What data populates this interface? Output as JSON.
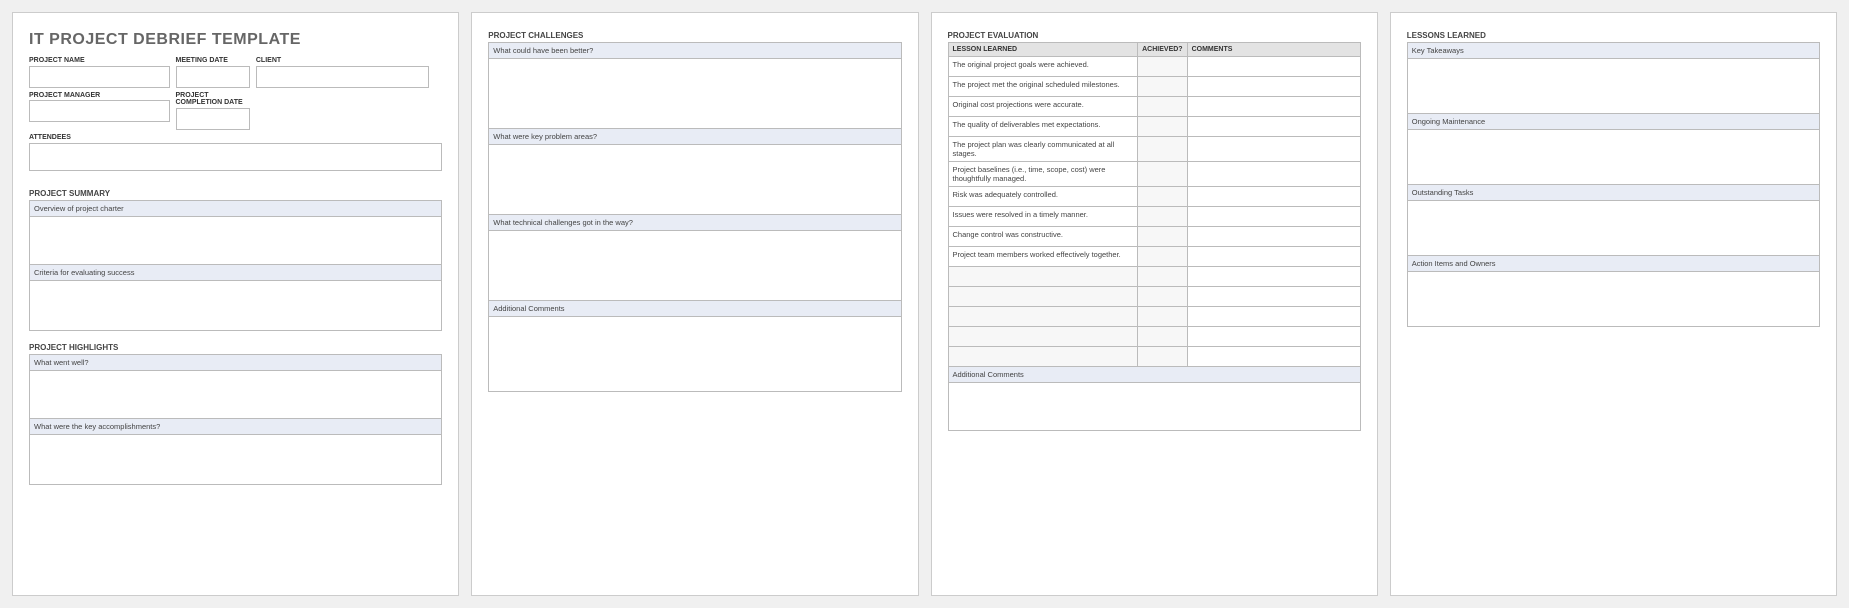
{
  "page1": {
    "title": "IT PROJECT DEBRIEF TEMPLATE",
    "fields": {
      "project_name": "PROJECT NAME",
      "meeting_date": "MEETING DATE",
      "client": "CLIENT",
      "project_manager": "PROJECT MANAGER",
      "completion_date": "PROJECT COMPLETION DATE",
      "attendees": "ATTENDEES"
    },
    "summary": {
      "section": "PROJECT SUMMARY",
      "overview": "Overview of project charter",
      "criteria": "Criteria for evaluating success"
    },
    "highlights": {
      "section": "PROJECT HIGHLIGHTS",
      "went_well": "What went well?",
      "accomplishments": "What were the key accomplishments?"
    }
  },
  "page2": {
    "challenges": {
      "section": "PROJECT CHALLENGES",
      "better": "What could have been better?",
      "problems": "What were key problem areas?",
      "technical": "What technical challenges got in the way?",
      "comments": "Additional Comments"
    }
  },
  "page3": {
    "evaluation": {
      "section": "PROJECT EVALUATION",
      "headers": {
        "lesson": "LESSON LEARNED",
        "achieved": "ACHIEVED?",
        "comments": "COMMENTS"
      },
      "rows": [
        "The original project goals were achieved.",
        "The project met the original scheduled milestones.",
        "Original cost projections were accurate.",
        "The quality of deliverables met expectations.",
        "The project plan was clearly communicated at all stages.",
        "Project baselines (i.e., time, scope, cost) were thoughtfully managed.",
        "Risk was adequately controlled.",
        "Issues were resolved in a timely manner.",
        "Change control was constructive.",
        "Project team members worked effectively together."
      ],
      "additional": "Additional Comments"
    }
  },
  "page4": {
    "lessons": {
      "section": "LESSONS LEARNED",
      "takeaways": "Key Takeaways",
      "maintenance": "Ongoing Maintenance",
      "outstanding": "Outstanding Tasks",
      "action": "Action Items and Owners"
    }
  }
}
